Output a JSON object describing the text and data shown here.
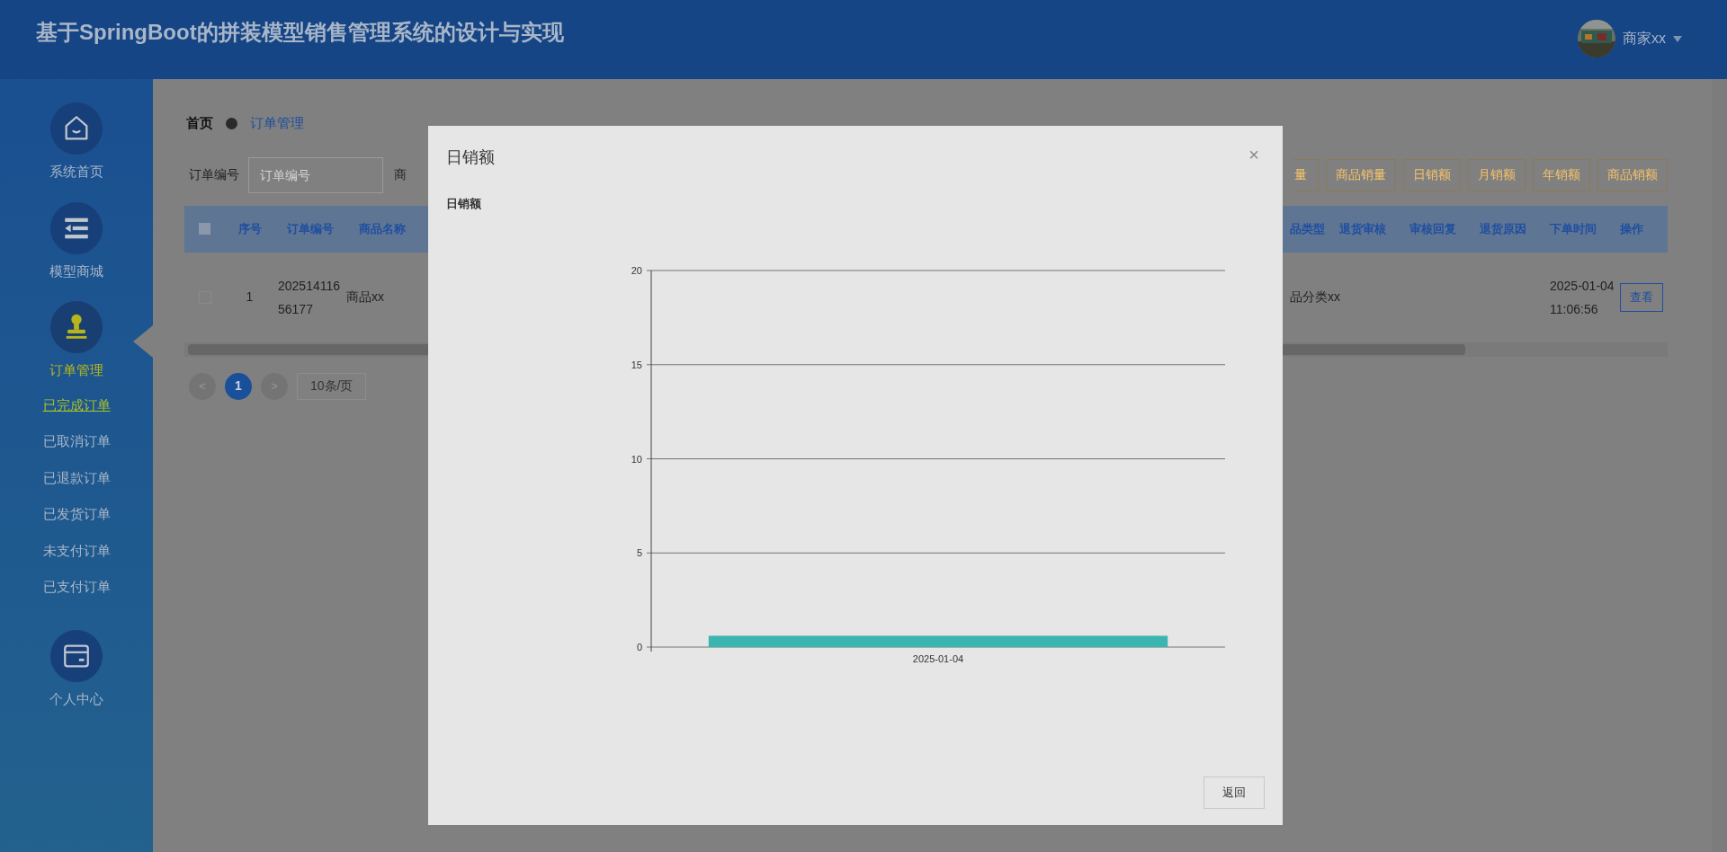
{
  "header": {
    "title": "基于SpringBoot的拼装模型销售管理系统的设计与实现",
    "user": {
      "name": "商家xx"
    }
  },
  "sidebar": {
    "items": [
      {
        "label": "系统首页",
        "selected": false
      },
      {
        "label": "模型商城",
        "selected": false
      },
      {
        "label": "订单管理",
        "selected": true,
        "children": [
          {
            "label": "已完成订单",
            "selected": true
          },
          {
            "label": "已取消订单",
            "selected": false
          },
          {
            "label": "已退款订单",
            "selected": false
          },
          {
            "label": "已发货订单",
            "selected": false
          },
          {
            "label": "未支付订单",
            "selected": false
          },
          {
            "label": "已支付订单",
            "selected": false
          }
        ]
      },
      {
        "label": "个人中心",
        "selected": false
      }
    ]
  },
  "breadcrumb": [
    "首页",
    "订单管理"
  ],
  "search": {
    "fields": [
      {
        "label": "订单编号",
        "placeholder": "订单编号"
      }
    ],
    "label_2": "商"
  },
  "toolbar": {
    "buttons": [
      "量",
      "商品销量",
      "日销额",
      "月销额",
      "年销额",
      "商品销额"
    ]
  },
  "table": {
    "select_all": {
      "checked": false
    },
    "columns_left": [
      "序号",
      "订单编号",
      "商品名称"
    ],
    "columns_right": [
      "品类型",
      "退货审核",
      "审核回复",
      "退货原因",
      "下单时间",
      "操作"
    ],
    "rows": [
      {
        "checked": false,
        "index": "1",
        "order_no": "20251411656177",
        "product": "商品xx",
        "category": "品分类xx",
        "time": "2025-01-04 11:06:56",
        "action": "查看"
      }
    ]
  },
  "pagination": {
    "prev": "<",
    "pages": [
      {
        "label": "1",
        "selected": true
      }
    ],
    "next": ">",
    "page_size": "10条/页"
  },
  "modal": {
    "title": "日销额",
    "close": "×",
    "buttons": [
      "返回"
    ],
    "chart_data": {
      "type": "bar",
      "title": "日销额",
      "categories": [
        "2025-01-04"
      ],
      "series": [
        {
          "color": "#3bb5b0",
          "values": [
            0.6
          ]
        }
      ],
      "ylim": [
        0,
        20
      ],
      "yticks": [
        0,
        5,
        10,
        15,
        20
      ],
      "grid": true
    }
  }
}
